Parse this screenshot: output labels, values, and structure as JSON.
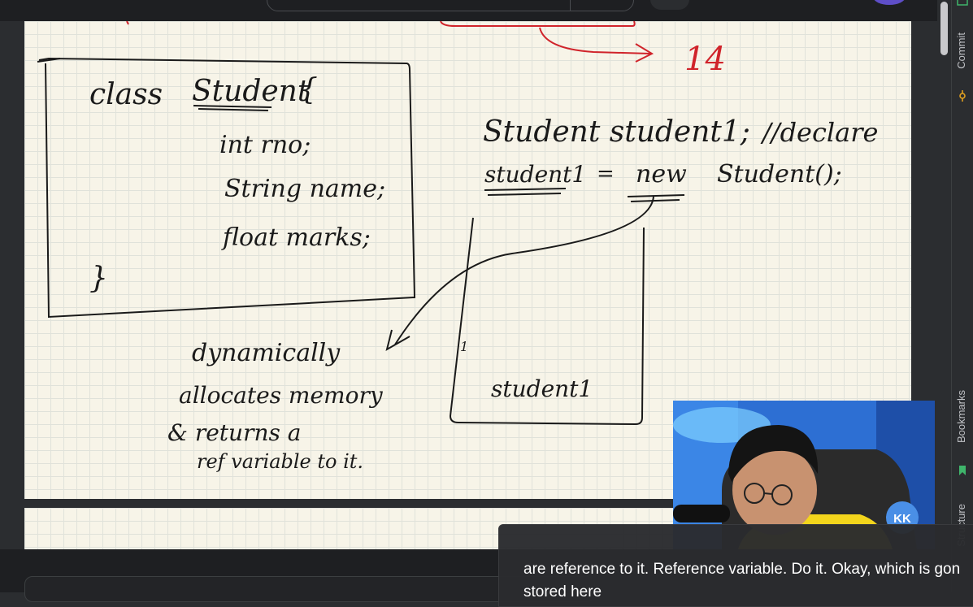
{
  "whiteboard": {
    "class_def": {
      "line1_keyword": "class",
      "line1_name": "Student",
      "line1_brace": "{",
      "field1": "int rno;",
      "field2": "String name;",
      "field3": "float marks;",
      "close_brace": "}"
    },
    "declaration": {
      "code": "Student student1;",
      "comment": "//declare"
    },
    "instantiation": {
      "lhs": "student1",
      "eq": "=",
      "new_kw": "new",
      "rhs": "Student();"
    },
    "top_number": "14",
    "note": {
      "line1": "dynamically",
      "line2": "allocates memory",
      "line3": "& returns a",
      "line4": "ref variable to it."
    },
    "box_label": "student1",
    "box_mark": "1"
  },
  "caption": {
    "line1": "are reference to it. Reference variable. Do it. Okay, which is gon",
    "line2": "stored here"
  },
  "webcam": {
    "badge": "KK"
  },
  "right_toolbar": {
    "commit": "Commit",
    "bookmarks": "Bookmarks",
    "structure": "Structure"
  },
  "colors": {
    "ink": "#1a1a1a",
    "red_ink": "#d0242b",
    "paper": "#f7f4e8",
    "ide_bg": "#2b2d30"
  }
}
